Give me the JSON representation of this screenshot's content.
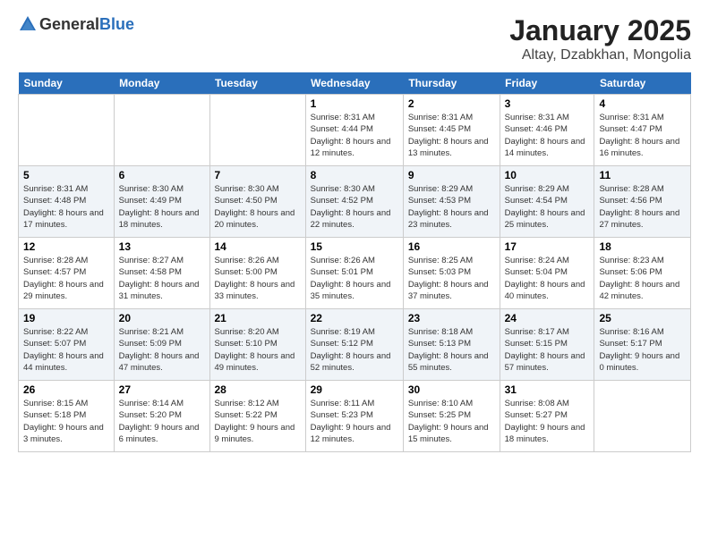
{
  "logo": {
    "general": "General",
    "blue": "Blue"
  },
  "title": "January 2025",
  "subtitle": "Altay, Dzabkhan, Mongolia",
  "days": [
    "Sunday",
    "Monday",
    "Tuesday",
    "Wednesday",
    "Thursday",
    "Friday",
    "Saturday"
  ],
  "weeks": [
    [
      {
        "day": "",
        "info": ""
      },
      {
        "day": "",
        "info": ""
      },
      {
        "day": "",
        "info": ""
      },
      {
        "day": "1",
        "sunrise": "8:31 AM",
        "sunset": "4:44 PM",
        "daylight": "8 hours and 12 minutes."
      },
      {
        "day": "2",
        "sunrise": "8:31 AM",
        "sunset": "4:45 PM",
        "daylight": "8 hours and 13 minutes."
      },
      {
        "day": "3",
        "sunrise": "8:31 AM",
        "sunset": "4:46 PM",
        "daylight": "8 hours and 14 minutes."
      },
      {
        "day": "4",
        "sunrise": "8:31 AM",
        "sunset": "4:47 PM",
        "daylight": "8 hours and 16 minutes."
      }
    ],
    [
      {
        "day": "5",
        "sunrise": "8:31 AM",
        "sunset": "4:48 PM",
        "daylight": "8 hours and 17 minutes."
      },
      {
        "day": "6",
        "sunrise": "8:30 AM",
        "sunset": "4:49 PM",
        "daylight": "8 hours and 18 minutes."
      },
      {
        "day": "7",
        "sunrise": "8:30 AM",
        "sunset": "4:50 PM",
        "daylight": "8 hours and 20 minutes."
      },
      {
        "day": "8",
        "sunrise": "8:30 AM",
        "sunset": "4:52 PM",
        "daylight": "8 hours and 22 minutes."
      },
      {
        "day": "9",
        "sunrise": "8:29 AM",
        "sunset": "4:53 PM",
        "daylight": "8 hours and 23 minutes."
      },
      {
        "day": "10",
        "sunrise": "8:29 AM",
        "sunset": "4:54 PM",
        "daylight": "8 hours and 25 minutes."
      },
      {
        "day": "11",
        "sunrise": "8:28 AM",
        "sunset": "4:56 PM",
        "daylight": "8 hours and 27 minutes."
      }
    ],
    [
      {
        "day": "12",
        "sunrise": "8:28 AM",
        "sunset": "4:57 PM",
        "daylight": "8 hours and 29 minutes."
      },
      {
        "day": "13",
        "sunrise": "8:27 AM",
        "sunset": "4:58 PM",
        "daylight": "8 hours and 31 minutes."
      },
      {
        "day": "14",
        "sunrise": "8:26 AM",
        "sunset": "5:00 PM",
        "daylight": "8 hours and 33 minutes."
      },
      {
        "day": "15",
        "sunrise": "8:26 AM",
        "sunset": "5:01 PM",
        "daylight": "8 hours and 35 minutes."
      },
      {
        "day": "16",
        "sunrise": "8:25 AM",
        "sunset": "5:03 PM",
        "daylight": "8 hours and 37 minutes."
      },
      {
        "day": "17",
        "sunrise": "8:24 AM",
        "sunset": "5:04 PM",
        "daylight": "8 hours and 40 minutes."
      },
      {
        "day": "18",
        "sunrise": "8:23 AM",
        "sunset": "5:06 PM",
        "daylight": "8 hours and 42 minutes."
      }
    ],
    [
      {
        "day": "19",
        "sunrise": "8:22 AM",
        "sunset": "5:07 PM",
        "daylight": "8 hours and 44 minutes."
      },
      {
        "day": "20",
        "sunrise": "8:21 AM",
        "sunset": "5:09 PM",
        "daylight": "8 hours and 47 minutes."
      },
      {
        "day": "21",
        "sunrise": "8:20 AM",
        "sunset": "5:10 PM",
        "daylight": "8 hours and 49 minutes."
      },
      {
        "day": "22",
        "sunrise": "8:19 AM",
        "sunset": "5:12 PM",
        "daylight": "8 hours and 52 minutes."
      },
      {
        "day": "23",
        "sunrise": "8:18 AM",
        "sunset": "5:13 PM",
        "daylight": "8 hours and 55 minutes."
      },
      {
        "day": "24",
        "sunrise": "8:17 AM",
        "sunset": "5:15 PM",
        "daylight": "8 hours and 57 minutes."
      },
      {
        "day": "25",
        "sunrise": "8:16 AM",
        "sunset": "5:17 PM",
        "daylight": "9 hours and 0 minutes."
      }
    ],
    [
      {
        "day": "26",
        "sunrise": "8:15 AM",
        "sunset": "5:18 PM",
        "daylight": "9 hours and 3 minutes."
      },
      {
        "day": "27",
        "sunrise": "8:14 AM",
        "sunset": "5:20 PM",
        "daylight": "9 hours and 6 minutes."
      },
      {
        "day": "28",
        "sunrise": "8:12 AM",
        "sunset": "5:22 PM",
        "daylight": "9 hours and 9 minutes."
      },
      {
        "day": "29",
        "sunrise": "8:11 AM",
        "sunset": "5:23 PM",
        "daylight": "9 hours and 12 minutes."
      },
      {
        "day": "30",
        "sunrise": "8:10 AM",
        "sunset": "5:25 PM",
        "daylight": "9 hours and 15 minutes."
      },
      {
        "day": "31",
        "sunrise": "8:08 AM",
        "sunset": "5:27 PM",
        "daylight": "9 hours and 18 minutes."
      },
      {
        "day": "",
        "info": ""
      }
    ]
  ]
}
